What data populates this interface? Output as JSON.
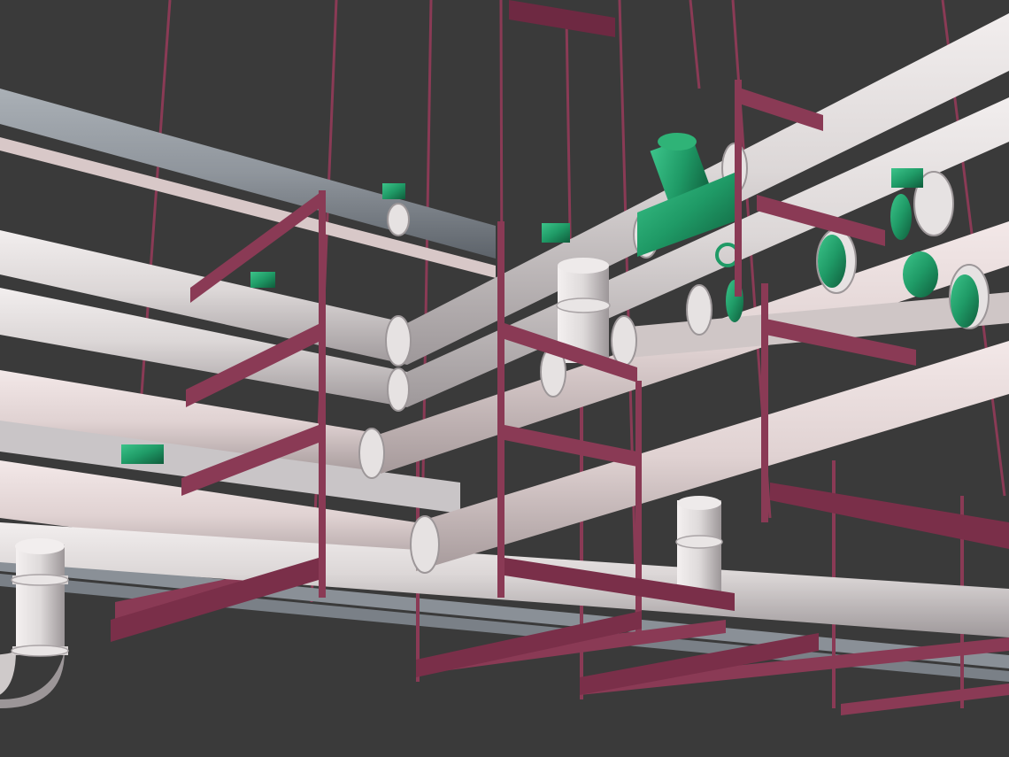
{
  "scene": {
    "kind": "3d-render-piping-model",
    "colors": {
      "background": "#3a3a3a",
      "pipe_light": "#dcd7d7",
      "pipe_light_shadow": "#a9a3a5",
      "pipe_grey": "#8f959c",
      "pipe_grey_shadow": "#5d636a",
      "pipe_pink": "#e5d8d8",
      "support_steel": "#8a3a55",
      "support_steel_dark": "#5e2239",
      "fitting_green": "#1f9a66",
      "fitting_green_dark": "#126845",
      "flange": "#cfcfcf"
    },
    "icons": [
      "pipe-hanger-rod",
      "pipe-clamp",
      "valve-handle",
      "strainer-fitting",
      "elbow-fitting"
    ]
  }
}
